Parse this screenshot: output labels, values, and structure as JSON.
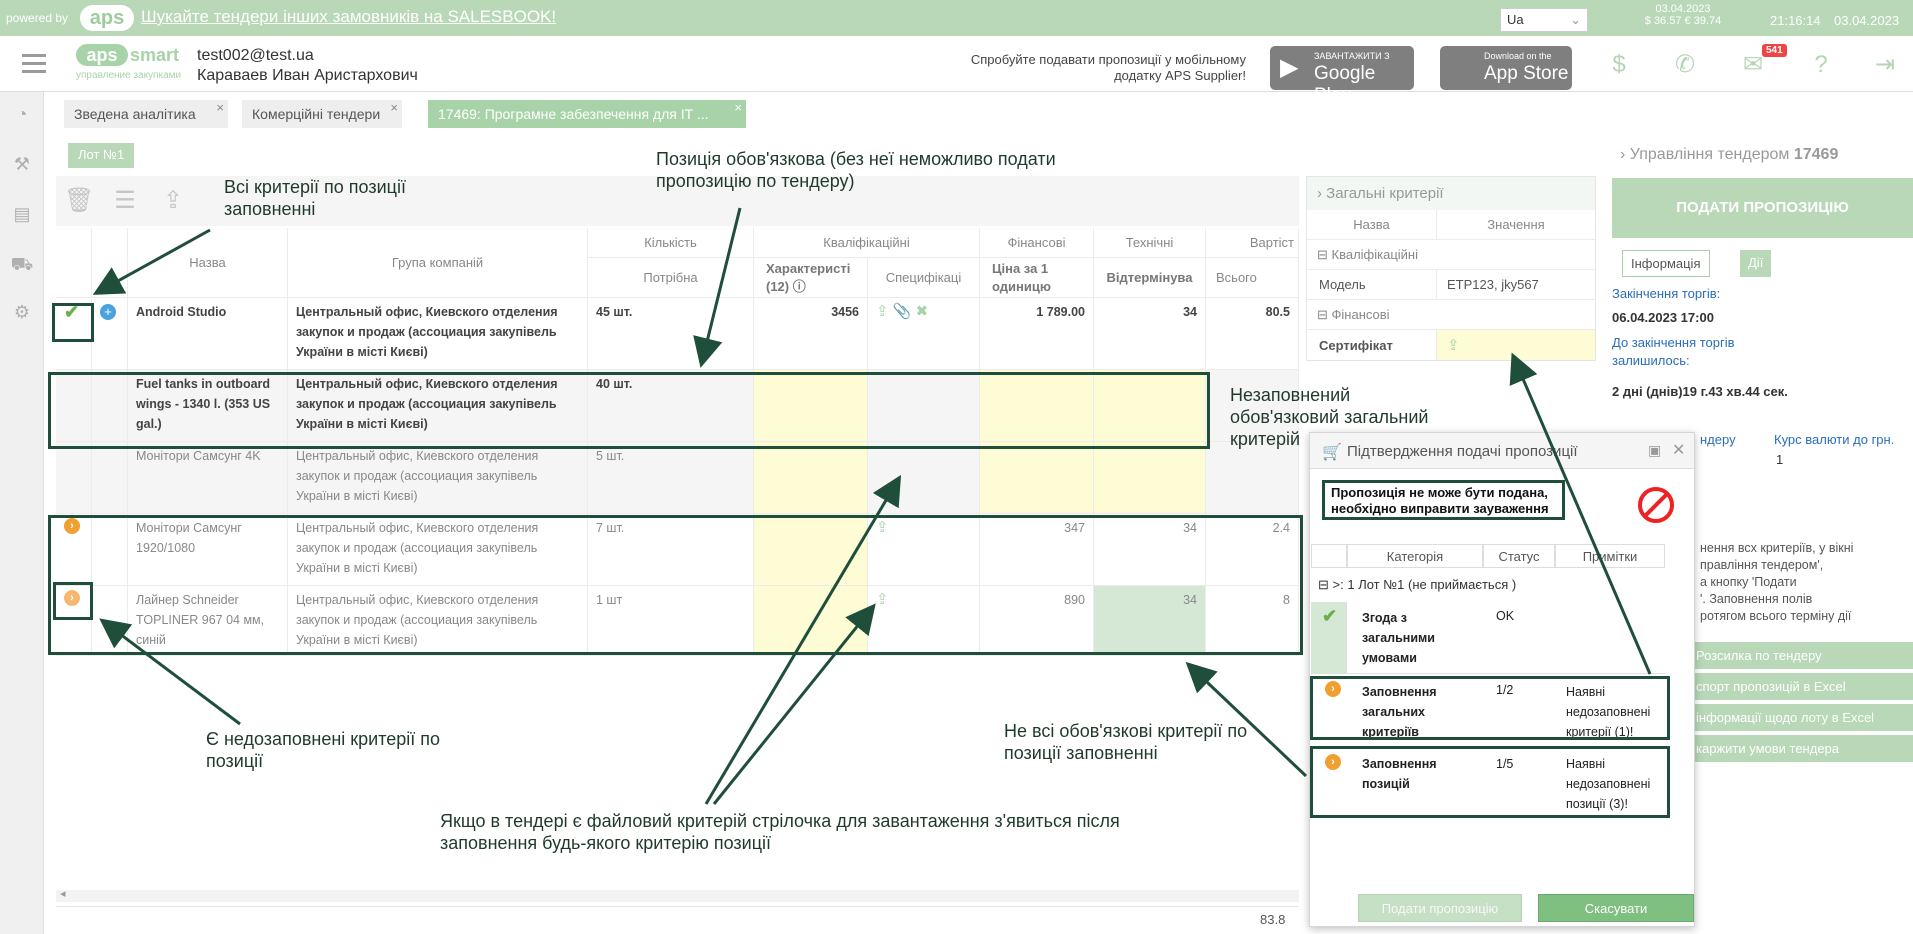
{
  "topbar": {
    "powered": "powered by",
    "logo": "aps",
    "promo": "Шукайте тендери інших замовників на SALESBOOK!",
    "lang": "Ua",
    "rate_date": "03.04.2023",
    "rates": "$ 36.57  € 39.74",
    "time": "21:16:14",
    "date": "03.04.2023"
  },
  "header": {
    "logo_main": "aps",
    "logo_smart": "smart",
    "logo_sub": "управление закупками",
    "email": "test002@test.ua",
    "name": "Караваев Иван Аристархович",
    "mobile_text": "Спробуйте подавати пропозиції у мобільному додатку APS Supplier!",
    "gp_small": "ЗАВАНТАЖИТИ З",
    "gp_big": "Google Play",
    "as_small": "Download on the",
    "as_big": "App Store",
    "mail_badge": "541"
  },
  "tabs": [
    {
      "label": "Зведена аналітика"
    },
    {
      "label": "Комерційні тендери"
    },
    {
      "label": "17469: Програмне забезпечення для IT ..."
    }
  ],
  "lot_button": "Лот №1",
  "table": {
    "group_headers": {
      "qty": "Кількість",
      "qual": "Кваліфікаційні",
      "fin": "Фінансові",
      "tech": "Технічні",
      "cost": "Вартіст"
    },
    "headers": {
      "name": "Назва",
      "company": "Група компаній",
      "required": "Потрібна",
      "characteristics": "Характеристі (12)",
      "specs": "Специфікаці",
      "price": "Ціна за 1 одиницю",
      "deferral": "Відтермінува",
      "total": "Всього"
    },
    "rows": [
      {
        "name": "Android Studio",
        "company": "Центральный офис, Киевского отделения закупок и продаж (ассоциация закупівель України в місті Києві)",
        "qty": "45 шт.",
        "char": "3456",
        "price": "1 789.00",
        "def": "34",
        "total": "80.5"
      },
      {
        "name": "Fuel tanks in outboard wings - 1340 l. (353 US gal.)",
        "company": "Центральный офис, Киевского отделения закупок и продаж (ассоциация закупівель України в місті Києві)",
        "qty": "40 шт."
      },
      {
        "name": "Монітори Самсунг 4K",
        "company": "Центральный офис, Киевского отделения закупок и продаж (ассоциация закупівель України в місті Києві)",
        "qty": "5 шт."
      },
      {
        "name": "Монітори Самсунг 1920/1080",
        "company": "Центральный офис, Киевского отделения закупок и продаж (ассоциация закупівель України в місті Києві)",
        "qty": "7 шт.",
        "price": "347",
        "def": "34",
        "total": "2.4"
      },
      {
        "name": "Лайнер Schneider TOPLINER 967 04 мм, синій",
        "company": "Центральный офис, Киевского отделения закупок и продаж (ассоциация закупівель України в місті Києві)",
        "qty": "1 шт",
        "price": "890",
        "def": "34",
        "total": "8"
      }
    ],
    "footer_total": "83.8"
  },
  "general_criteria": {
    "title": "Загальні критерії",
    "col_name": "Назва",
    "col_value": "Значення",
    "section_qual": "Кваліфікаційні",
    "model_label": "Модель",
    "model_value": "ETP123, jky567",
    "section_fin": "Фінансові",
    "cert_label": "Сертифікат"
  },
  "management": {
    "title_prefix": "Управління тендером",
    "tender_no": "17469",
    "submit": "ПОДАТИ ПРОПОЗИЦІЮ",
    "tab_info": "Інформація",
    "tab_actions": "Дії",
    "end_label": "Закінчення торгів:",
    "end_value": "06.04.2023 17:00",
    "remaining_label": "До закінчення торгів залишилось:",
    "remaining_value": "2 дні (днів)19 г.43 хв.44 сек.",
    "tender_frag": "ндеру",
    "currency_label": "Курс валюти до грн.",
    "currency_value": "1",
    "note_lines": [
      "нення всх критеріїв, у вікні",
      "правління тендером',",
      "а кнопку 'Подати",
      "'. Заповнення полів",
      "ротягом всього терміну дії"
    ],
    "side_buttons": [
      "Розсилка по тендеру",
      "спорт пропозицій в Excel",
      "інформації щодо лоту в Excel",
      "каржити умови тендера"
    ]
  },
  "dialog": {
    "title": "Підтвердження подачі пропозиції",
    "message": "Пропозиція не може бути подана, необхідно виправити зауваження",
    "col_category": "Категорія",
    "col_status": "Статус",
    "col_notes": "Примітки",
    "group": ">: 1 Лот №1 (не приймається )",
    "rows": [
      {
        "category": "Згода з загальними умовами",
        "status": "OK",
        "notes": ""
      },
      {
        "category": "Заповнення загальних критеріїв",
        "status": "1/2",
        "notes": "Наявні недозаповнені критерії (1)!"
      },
      {
        "category": "Заповнення позицій",
        "status": "1/5",
        "notes": "Наявні недозаповнені позиції (3)!"
      }
    ],
    "btn_submit": "Подати пропозицію",
    "btn_cancel": "Скасувати"
  },
  "annotations": {
    "all_filled": "Всі критерії по позиції заповненні",
    "mandatory": "Позиція обов'язкова (без неї неможливо подати пропозицію по тендеру)",
    "unfilled_general": "Незаповнений обов'язковий загальний критерій",
    "partial": "Є недозаповнені критерії по позиції",
    "not_all": "Не всі обов'язкові критерії по позиції заповненні",
    "file_crit": "Якщо в тендері є файловий критерій стрілочка для завантаження з'явиться після заповнення будь-якого критерію позиції"
  },
  "colors": {
    "accent": "#a8d3a8",
    "annotation": "#1f4e3a",
    "warning": "#f0a030",
    "error": "#e22222"
  }
}
